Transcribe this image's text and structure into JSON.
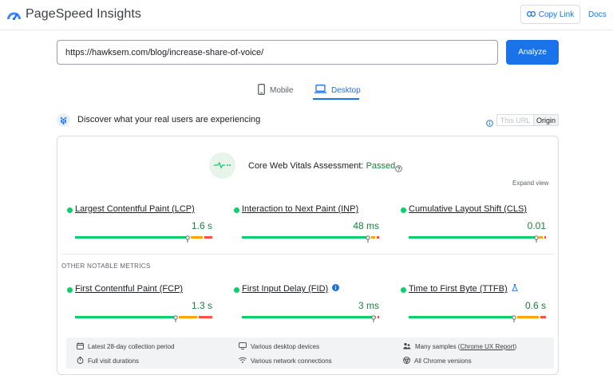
{
  "header": {
    "app_title": "PageSpeed Insights",
    "copy_link_label": "Copy Link",
    "docs_label": "Docs"
  },
  "search": {
    "url_value": "https://hawksem.com/blog/increase-share-of-voice/",
    "analyze_label": "Analyze"
  },
  "tabs": [
    {
      "label": "Mobile",
      "icon": "phone-icon",
      "active": false
    },
    {
      "label": "Desktop",
      "icon": "laptop-icon",
      "active": true
    }
  ],
  "field_data": {
    "title": "Discover what your real users are experiencing",
    "toggle": {
      "this_url": "This URL",
      "origin": "Origin",
      "selected": "Origin"
    }
  },
  "assessment": {
    "label": "Core Web Vitals Assessment:",
    "status": "Passed",
    "expand_label": "Expand view"
  },
  "core_metrics": [
    {
      "name": "Largest Contentful Paint (LCP)",
      "value": "1.6 s",
      "distribution": [
        0.85,
        0.09,
        0.06
      ]
    },
    {
      "name": "Interaction to Next Paint (INP)",
      "value": "48 ms",
      "distribution": [
        0.95,
        0.03,
        0.02
      ]
    },
    {
      "name": "Cumulative Layout Shift (CLS)",
      "value": "0.01",
      "distribution": [
        0.96,
        0.03,
        0.01
      ]
    }
  ],
  "other_label": "OTHER NOTABLE METRICS",
  "other_metrics": [
    {
      "name": "First Contentful Paint (FCP)",
      "value": "1.3 s",
      "distribution": [
        0.76,
        0.14,
        0.1
      ],
      "extra_icon": ""
    },
    {
      "name": "First Input Delay (FID)",
      "value": "3 ms",
      "distribution": [
        0.99,
        0.005,
        0.005
      ],
      "extra_icon": "info-icon"
    },
    {
      "name": "Time to First Byte (TTFB)",
      "value": "0.6 s",
      "distribution": [
        0.8,
        0.16,
        0.04
      ],
      "extra_icon": "flask-icon"
    }
  ],
  "footer_items": [
    {
      "text": "Latest 28-day collection period",
      "icon": "calendar-icon"
    },
    {
      "text": "Various desktop devices",
      "icon": "monitor-icon"
    },
    {
      "text": "Many samples (",
      "link": "Chrome UX Report",
      "suffix": ")",
      "icon": "people-icon"
    },
    {
      "text": "Full visit durations",
      "icon": "stopwatch-icon"
    },
    {
      "text": "Various network connections",
      "icon": "wifi-icon"
    },
    {
      "text": "All Chrome versions",
      "icon": "chrome-icon"
    }
  ],
  "colors": {
    "accent": "#1a73e8",
    "good": "#0cce6b",
    "average": "#ffa400",
    "poor": "#ff4e42",
    "pass_text": "#188038"
  }
}
